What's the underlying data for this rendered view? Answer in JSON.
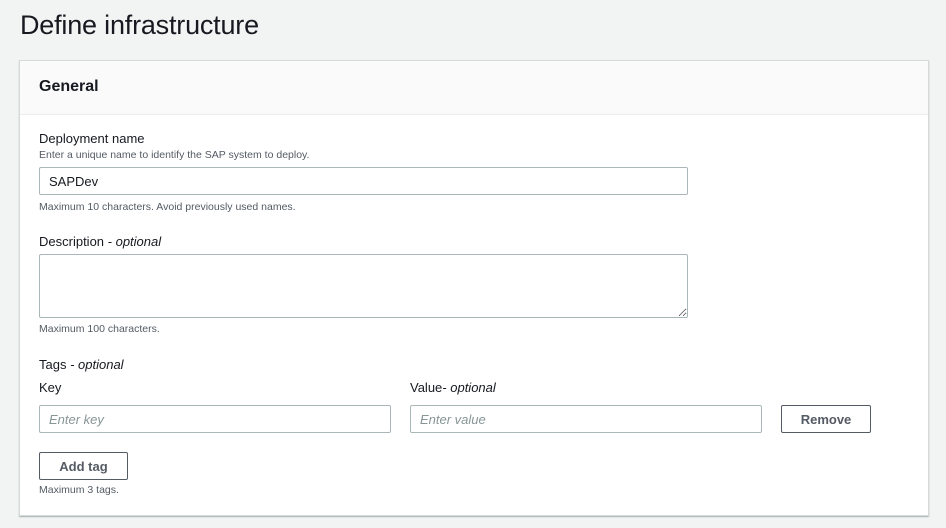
{
  "page": {
    "title": "Define infrastructure"
  },
  "general": {
    "heading": "General",
    "deployment_name": {
      "label": "Deployment name",
      "description": "Enter a unique name to identify the SAP system to deploy.",
      "value": "SAPDev",
      "constraint": "Maximum 10 characters. Avoid previously used names."
    },
    "description_field": {
      "label": "Description",
      "optional_suffix": "- optional",
      "value": "",
      "constraint": "Maximum 100 characters."
    },
    "tags": {
      "label": "Tags",
      "optional_suffix": "- optional",
      "key_label": "Key",
      "value_label": "Value",
      "value_optional_suffix": "- optional",
      "key_placeholder": "Enter key",
      "value_placeholder": "Enter value",
      "remove_label": "Remove",
      "add_label": "Add tag",
      "constraint": "Maximum 3 tags."
    }
  }
}
